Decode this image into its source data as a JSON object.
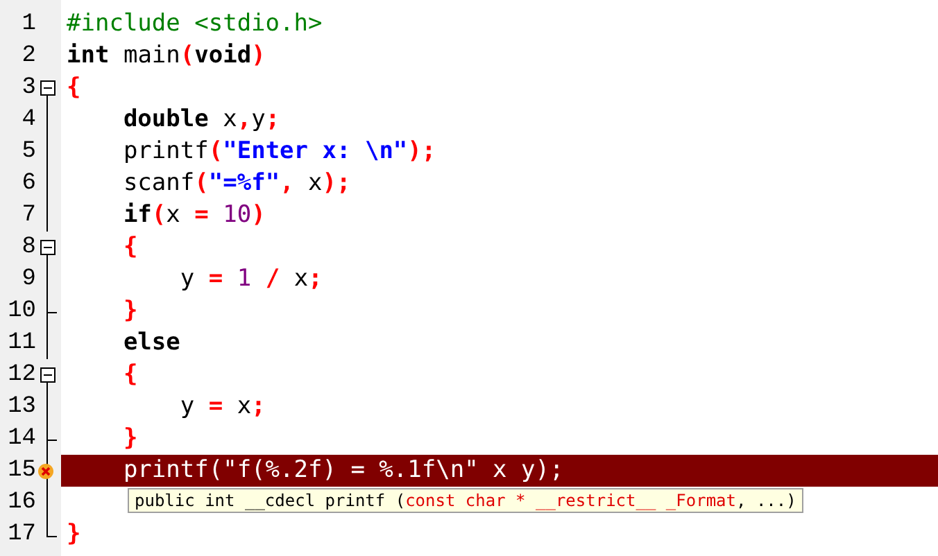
{
  "editor": {
    "lines": [
      {
        "number": "1",
        "kind": "plain",
        "highlighted": false,
        "tokens": [
          {
            "kind": "preproc",
            "text": "#include <stdio.h>"
          }
        ]
      },
      {
        "number": "2",
        "kind": "plain",
        "highlighted": false,
        "tokens": [
          {
            "kind": "keyword",
            "text": "int"
          },
          {
            "kind": "plain",
            "text": " main"
          },
          {
            "kind": "punct",
            "text": "("
          },
          {
            "kind": "keyword",
            "text": "void"
          },
          {
            "kind": "punct",
            "text": ")"
          }
        ]
      },
      {
        "number": "3",
        "kind": "fold_start",
        "highlighted": false,
        "tokens": [
          {
            "kind": "punct",
            "text": "{"
          }
        ]
      },
      {
        "number": "4",
        "kind": "fold_body",
        "highlighted": false,
        "tokens": [
          {
            "kind": "keyword",
            "text": "    double"
          },
          {
            "kind": "plain",
            "text": " x"
          },
          {
            "kind": "punct",
            "text": ","
          },
          {
            "kind": "plain",
            "text": "y"
          },
          {
            "kind": "punct",
            "text": ";"
          }
        ]
      },
      {
        "number": "5",
        "kind": "fold_body",
        "highlighted": false,
        "tokens": [
          {
            "kind": "plain",
            "text": "    printf"
          },
          {
            "kind": "punct",
            "text": "("
          },
          {
            "kind": "string",
            "text": "\"Enter x: \\n\""
          },
          {
            "kind": "punct",
            "text": ");"
          }
        ]
      },
      {
        "number": "6",
        "kind": "fold_body",
        "highlighted": false,
        "tokens": [
          {
            "kind": "plain",
            "text": "    scanf"
          },
          {
            "kind": "punct",
            "text": "("
          },
          {
            "kind": "string",
            "text": "\"=%f\""
          },
          {
            "kind": "punct",
            "text": ","
          },
          {
            "kind": "plain",
            "text": " x"
          },
          {
            "kind": "punct",
            "text": ");"
          }
        ]
      },
      {
        "number": "7",
        "kind": "fold_body",
        "highlighted": false,
        "tokens": [
          {
            "kind": "keyword",
            "text": "    if"
          },
          {
            "kind": "punct",
            "text": "("
          },
          {
            "kind": "plain",
            "text": "x "
          },
          {
            "kind": "punct",
            "text": "="
          },
          {
            "kind": "number",
            "text": " 10"
          },
          {
            "kind": "punct",
            "text": ")"
          }
        ]
      },
      {
        "number": "8",
        "kind": "fold_start",
        "highlighted": false,
        "tokens": [
          {
            "kind": "punct",
            "text": "    {"
          }
        ]
      },
      {
        "number": "9",
        "kind": "fold_body",
        "highlighted": false,
        "tokens": [
          {
            "kind": "plain",
            "text": "        y "
          },
          {
            "kind": "punct",
            "text": "="
          },
          {
            "kind": "number",
            "text": " 1"
          },
          {
            "kind": "punct",
            "text": " /"
          },
          {
            "kind": "plain",
            "text": " x"
          },
          {
            "kind": "punct",
            "text": ";"
          }
        ]
      },
      {
        "number": "10",
        "kind": "fold_end",
        "highlighted": false,
        "tokens": [
          {
            "kind": "punct",
            "text": "    }"
          }
        ]
      },
      {
        "number": "11",
        "kind": "fold_body",
        "highlighted": false,
        "tokens": [
          {
            "kind": "keyword",
            "text": "    else"
          }
        ]
      },
      {
        "number": "12",
        "kind": "fold_start",
        "highlighted": false,
        "tokens": [
          {
            "kind": "punct",
            "text": "    {"
          }
        ]
      },
      {
        "number": "13",
        "kind": "fold_body",
        "highlighted": false,
        "tokens": [
          {
            "kind": "plain",
            "text": "        y "
          },
          {
            "kind": "punct",
            "text": "="
          },
          {
            "kind": "plain",
            "text": " x"
          },
          {
            "kind": "punct",
            "text": ";"
          }
        ]
      },
      {
        "number": "14",
        "kind": "fold_end",
        "highlighted": false,
        "tokens": [
          {
            "kind": "punct",
            "text": "    }"
          }
        ]
      },
      {
        "number": "15",
        "kind": "fold_body",
        "highlighted": true,
        "error": true,
        "tokens": [
          {
            "kind": "plain",
            "text": "    printf(\"f(%.2f) = %.1f\\n\" x y);"
          }
        ],
        "tooltip": [
          {
            "kind": "plain",
            "text": "public int __cdecl printf ("
          },
          {
            "kind": "param",
            "text": "const char * __restrict__ _Format"
          },
          {
            "kind": "plain",
            "text": ", ...)"
          }
        ]
      },
      {
        "number": "16",
        "kind": "fold_body",
        "highlighted": false
      },
      {
        "number": "17",
        "kind": "fold_last",
        "highlighted": false,
        "tokens": [
          {
            "kind": "punct",
            "text": "}"
          }
        ]
      }
    ]
  }
}
